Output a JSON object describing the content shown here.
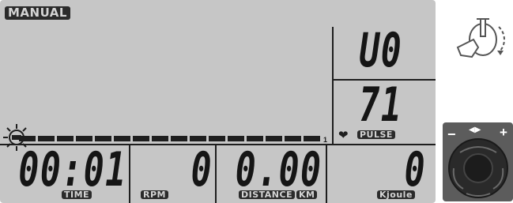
{
  "program": {
    "mode_label": "MANUAL"
  },
  "display": {
    "level_value": "U0",
    "pulse": {
      "value": "71",
      "label": "PULSE"
    },
    "time": {
      "value": "00:01",
      "label": "TIME"
    },
    "rpm": {
      "value": "0",
      "label": "RPM"
    },
    "distance": {
      "value": "0.00",
      "label": "DISTANCE",
      "unit": "KM"
    },
    "energy": {
      "value": "0",
      "label": "Kjoule"
    },
    "profile_scale": {
      "end_label": "1",
      "bar_count": 16,
      "level": 1
    }
  },
  "controls": {
    "minus_label": "−",
    "plus_label": "+",
    "arrows_label": "◀▶"
  },
  "colors": {
    "lcd_background": "#c6c6c6",
    "segment_dark": "#151515",
    "knob_panel": "#5c5c5c"
  }
}
